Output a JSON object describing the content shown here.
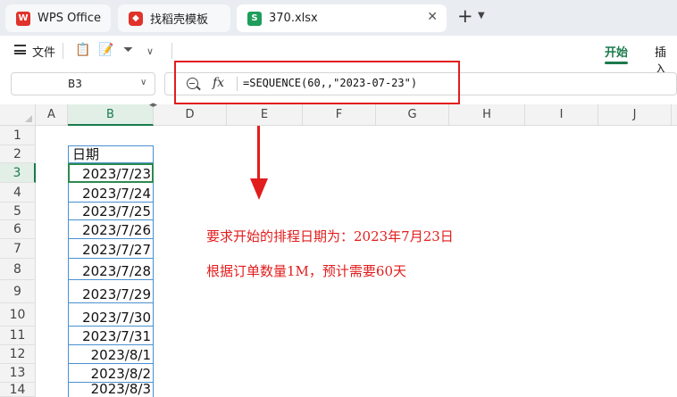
{
  "tabs": [
    {
      "label": "WPS Office",
      "icon": "wps-logo-icon"
    },
    {
      "label": "找稻壳模板",
      "icon": "docer-template-icon"
    },
    {
      "label": "370.xlsx",
      "icon": "spreadsheet-icon",
      "active": true
    }
  ],
  "toolbar": {
    "file_label": "文件",
    "ribbon_tabs": [
      "开始",
      "插入"
    ],
    "active_ribbon_tab": "开始"
  },
  "formula_bar": {
    "cell_reference": "B3",
    "fx_label": "fx",
    "formula": "=SEQUENCE(60,,\"2023-07-23\")"
  },
  "columns": [
    "A",
    "B",
    "D",
    "E",
    "F",
    "G",
    "H",
    "I",
    "J"
  ],
  "selected_column": "B",
  "selected_row": "3",
  "rows": [
    "1",
    "2",
    "3",
    "4",
    "5",
    "6",
    "7",
    "8",
    "9",
    "10",
    "11",
    "12",
    "13",
    "14"
  ],
  "column_b": {
    "header": "日期",
    "values": [
      "2023/7/23",
      "2023/7/24",
      "2023/7/25",
      "2023/7/26",
      "2023/7/27",
      "2023/7/28",
      "2023/7/29",
      "2023/7/30",
      "2023/7/31",
      "2023/8/1",
      "2023/8/2",
      "2023/8/3"
    ]
  },
  "notes": [
    "要求开始的排程日期为：2023年7月23日",
    "根据订单数量1M，预计需要60天"
  ],
  "colors": {
    "accent": "#1a7a4c",
    "annotation": "#e21d1d",
    "selection_border": "#4a90d0"
  }
}
